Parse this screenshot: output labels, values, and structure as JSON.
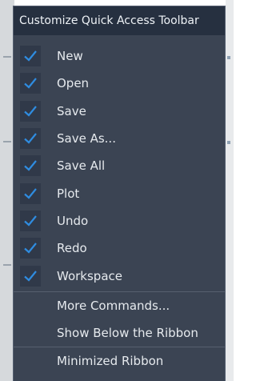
{
  "menu": {
    "title": "Customize Quick Access Toolbar",
    "checked_items": [
      {
        "label": "New",
        "checked": true
      },
      {
        "label": "Open",
        "checked": true
      },
      {
        "label": "Save",
        "checked": true
      },
      {
        "label": "Save As...",
        "checked": true
      },
      {
        "label": "Save All",
        "checked": true
      },
      {
        "label": "Plot",
        "checked": true
      },
      {
        "label": "Undo",
        "checked": true
      },
      {
        "label": "Redo",
        "checked": true
      },
      {
        "label": "Workspace",
        "checked": true
      }
    ],
    "more_commands": "More Commands...",
    "show_below_ribbon": "Show Below the Ribbon",
    "minimized_ribbon": "Minimized Ribbon"
  },
  "colors": {
    "menu_bg": "#3b4453",
    "header_bg": "#263040",
    "check_color": "#2f8ce0"
  },
  "icons": {
    "check": "check-icon"
  }
}
